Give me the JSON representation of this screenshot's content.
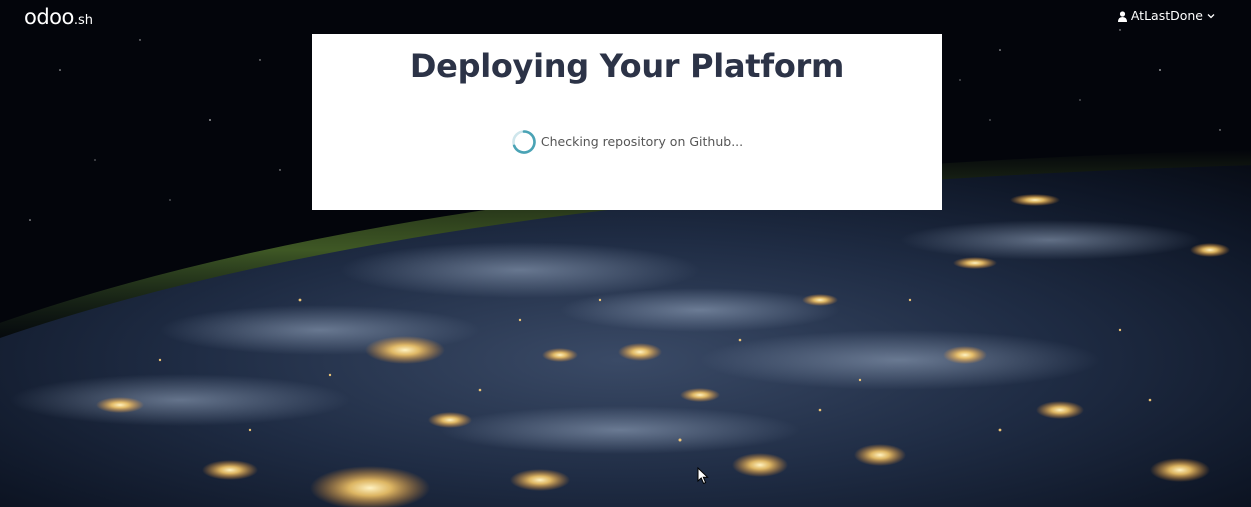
{
  "header": {
    "logo_main": "odoo",
    "logo_suffix": ".sh",
    "user_name": "AtLastDone"
  },
  "panel": {
    "title": "Deploying Your Platform",
    "status_text": "Checking repository on Github..."
  },
  "colors": {
    "title": "#2c3347",
    "spinner": "#4aa3b5",
    "panel_bg": "#ffffff"
  },
  "icons": [
    "user-icon",
    "chevron-down-icon",
    "loading-spinner-icon",
    "mouse-cursor-icon"
  ]
}
